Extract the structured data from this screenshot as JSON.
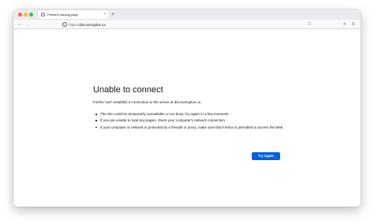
{
  "browser": {
    "tab_title": "Problem loading page",
    "tab_close_glyph": "×",
    "new_tab_glyph": "+",
    "back_glyph": "←",
    "forward_glyph": "→",
    "url_scheme": "https://",
    "url_host": "discoveryplus.ca",
    "info_glyph": "i",
    "bookmark_glyph": "☆",
    "overflow_glyph": "»",
    "menu_glyph": "≡"
  },
  "error": {
    "title": "Unable to connect",
    "description": "Firefox can’t establish a connection to the server at discoveryplus.ca.",
    "items": [
      "The site could be temporarily unavailable or too busy. Try again in a few moments.",
      "If you are unable to load any pages, check your computer’s network connection.",
      "If your computer or network is protected by a firewall or proxy, make sure that Firefox is permitted to access the Web."
    ],
    "button_label": "Try Again"
  },
  "colors": {
    "accent": "#0061e0",
    "close": "#ff5f57",
    "minimize": "#febc2e",
    "maximize": "#28c840"
  }
}
